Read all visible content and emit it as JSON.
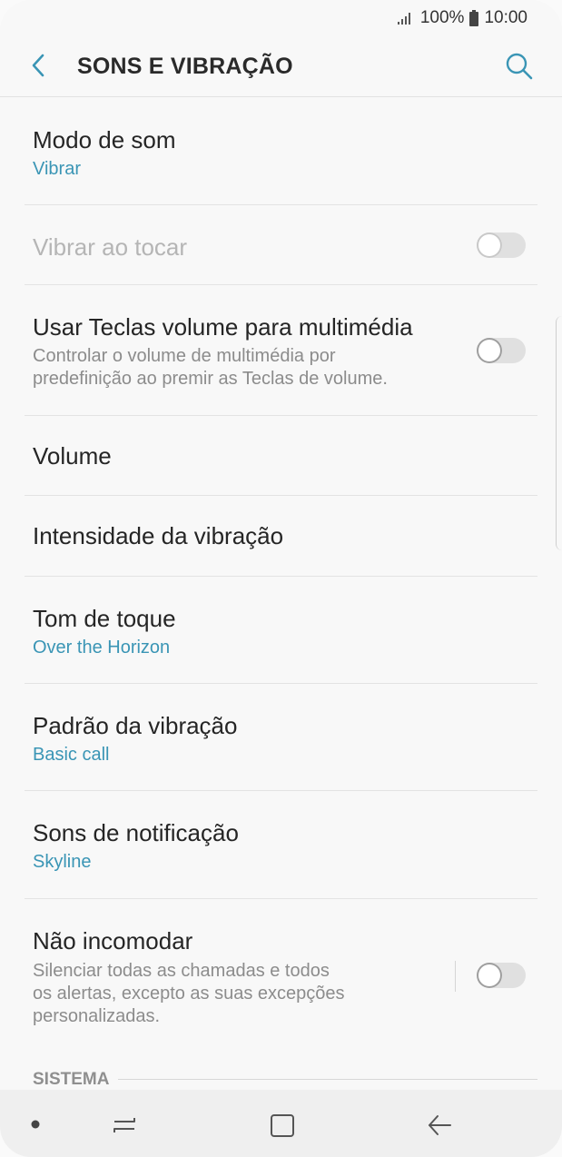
{
  "status": {
    "battery": "100%",
    "time": "10:00"
  },
  "header": {
    "title": "SONS E VIBRAÇÃO"
  },
  "items": [
    {
      "title": "Modo de som",
      "value": "Vibrar"
    },
    {
      "title": "Vibrar ao tocar"
    },
    {
      "title": "Usar Teclas volume para multimédia",
      "desc1": "Controlar o volume de multimédia por",
      "desc2": "predefinição ao premir as Teclas de volume."
    },
    {
      "title": "Volume"
    },
    {
      "title": "Intensidade da vibração"
    },
    {
      "title": "Tom de toque",
      "value": "Over the Horizon"
    },
    {
      "title": "Padrão da vibração",
      "value": "Basic call"
    },
    {
      "title": "Sons de notificação",
      "value": "Skyline"
    },
    {
      "title": "Não incomodar",
      "desc1": "Silenciar todas as chamadas e todos",
      "desc2": "os alertas, excepto as suas excepções",
      "desc3": "personalizadas."
    }
  ],
  "section": {
    "label": "SISTEMA"
  },
  "icons": {
    "back": "chevron-left-icon",
    "search": "search-icon"
  },
  "colors": {
    "accent": "#3a95b5"
  }
}
